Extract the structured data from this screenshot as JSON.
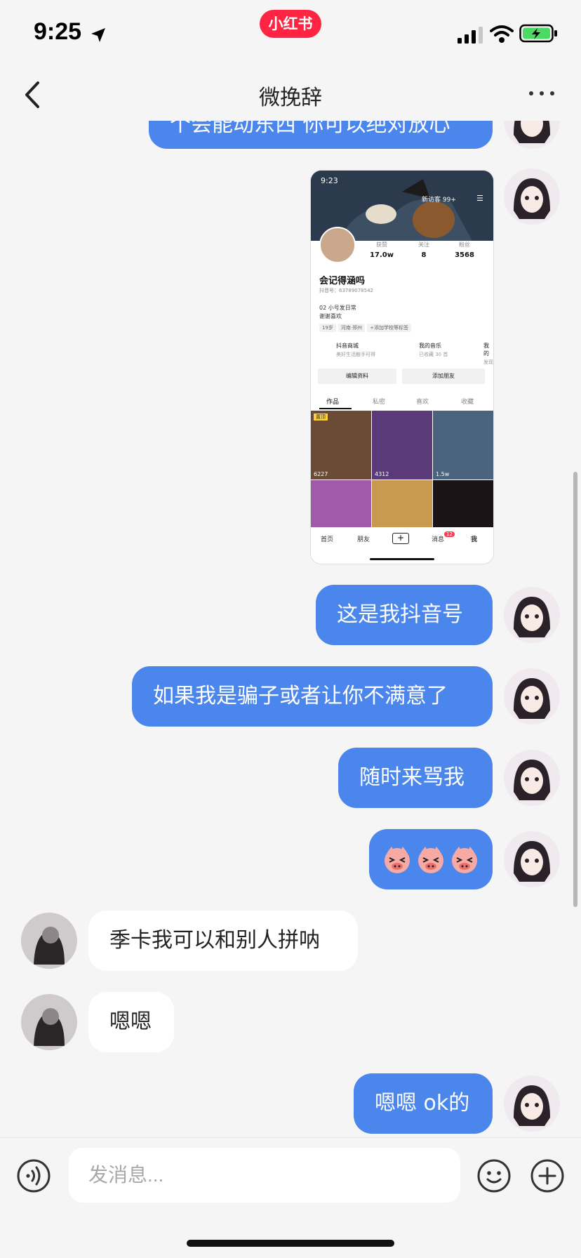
{
  "status_bar": {
    "time": "9:25",
    "app_badge": "小红书"
  },
  "header": {
    "title": "微挽辞"
  },
  "messages": [
    {
      "side": "out",
      "text": "个会能动东西 你可以绝对放心"
    },
    {
      "side": "out",
      "type": "image"
    },
    {
      "side": "out",
      "text": "这是我抖音号"
    },
    {
      "side": "out",
      "text": "如果我是骗子或者让你不满意了"
    },
    {
      "side": "out",
      "text": "随时来骂我"
    },
    {
      "side": "out",
      "type": "stickers",
      "icons": [
        "pig-face-icon",
        "pig-face-icon",
        "pig-face-icon"
      ]
    },
    {
      "side": "in",
      "text": "季卡我可以和别人拼呐"
    },
    {
      "side": "in",
      "text": "嗯嗯"
    },
    {
      "side": "out",
      "text": "嗯嗯 ok的"
    }
  ],
  "shared_screenshot": {
    "time": "9:23",
    "visitors": "新访客 99+",
    "stats": [
      {
        "label": "获赞",
        "value": "17.0w"
      },
      {
        "label": "关注",
        "value": "8"
      },
      {
        "label": "粉丝",
        "value": "3568"
      }
    ],
    "name": "会记得涵吗",
    "douyin_id": "抖音号：63789078542",
    "bio_line1": "02 小号发日常",
    "bio_line2": "谢谢喜欢",
    "tags": [
      "19岁",
      "河南·郑州",
      "+添加学校等标签"
    ],
    "entries": [
      {
        "title": "抖音商城",
        "sub": "美好生活触手可得"
      },
      {
        "title": "我的音乐",
        "sub": "已收藏 30 首"
      },
      {
        "title": "我的",
        "sub": "发现"
      }
    ],
    "buttons": [
      "编辑资料",
      "添加朋友"
    ],
    "tabs": [
      "作品",
      "私密",
      "喜欢",
      "收藏"
    ],
    "pinned_label": "置顶",
    "tile_counts": [
      "6227",
      "4312",
      "1.5w"
    ],
    "bottom_nav": [
      "首页",
      "朋友",
      "消息",
      "我"
    ],
    "message_badge": "12"
  },
  "input": {
    "placeholder": "发消息..."
  },
  "colors": {
    "outgoing_bubble": "#4a86eb",
    "incoming_bubble": "#ffffff",
    "background": "#f5f5f5",
    "brand": "#ff2442"
  }
}
